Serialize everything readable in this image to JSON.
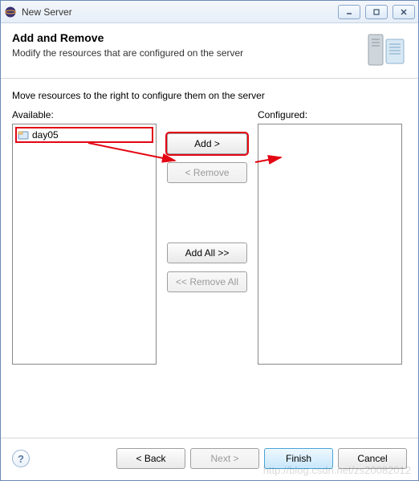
{
  "window": {
    "title": "New Server"
  },
  "header": {
    "title": "Add and Remove",
    "subtitle": "Modify the resources that are configured on the server"
  },
  "content": {
    "instruction": "Move resources to the right to configure them on the server",
    "available_label": "Available:",
    "configured_label": "Configured:",
    "available_items": [
      {
        "label": "day05"
      }
    ]
  },
  "buttons": {
    "add": "Add >",
    "remove": "< Remove",
    "add_all": "Add All >>",
    "remove_all": "<< Remove All"
  },
  "footer": {
    "back": "< Back",
    "next": "Next >",
    "finish": "Finish",
    "cancel": "Cancel"
  },
  "watermark": "http://blog.csdn.net/zs20082012"
}
